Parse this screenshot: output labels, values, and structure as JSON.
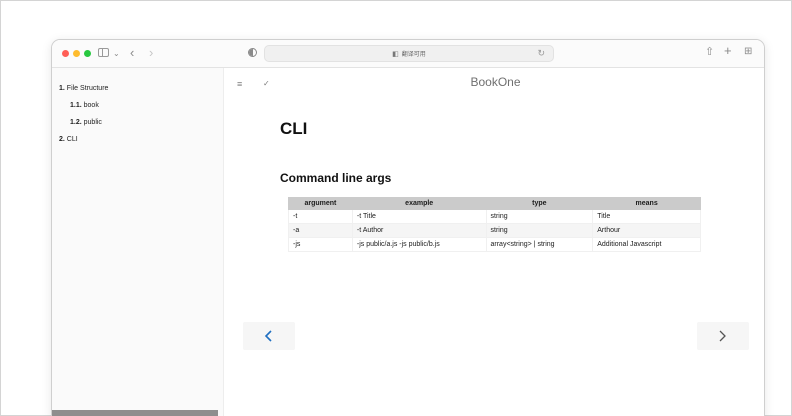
{
  "browser": {
    "address_text": "翻译可用",
    "icons": {
      "translate": "translate-icon",
      "reload": "reload-icon",
      "share": "share-icon",
      "new_tab": "plus-icon",
      "tabs": "tab-overview-icon"
    }
  },
  "sidebar": {
    "items": [
      {
        "number": "1.",
        "label": "File Structure"
      },
      {
        "number": "1.1.",
        "label": "book"
      },
      {
        "number": "1.2.",
        "label": "public"
      },
      {
        "number": "2.",
        "label": "CLI"
      }
    ]
  },
  "page": {
    "book_title": "BookOne",
    "heading": "CLI",
    "subheading": "Command line args"
  },
  "table": {
    "headers": [
      "argument",
      "example",
      "type",
      "means"
    ],
    "rows": [
      [
        "-t",
        "-t Title",
        "string",
        "Title"
      ],
      [
        "-a",
        "-t Author",
        "string",
        "Arthour"
      ],
      [
        "-js",
        "-js public/a.js -js public/b.js",
        "array<string> | string",
        "Additional Javascript"
      ]
    ]
  },
  "colors": {
    "accent": "#1f6fc2",
    "light_red": "#ff5f57",
    "light_yellow": "#febc2e",
    "light_green": "#28c840"
  }
}
